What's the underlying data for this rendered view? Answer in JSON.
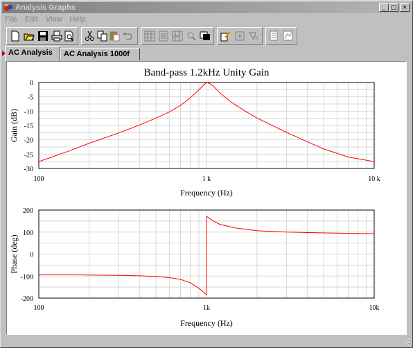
{
  "window": {
    "title": "Analysis Graphs",
    "controls": {
      "minimize": "_",
      "maximize": "□",
      "close": "×"
    }
  },
  "menu": [
    "File",
    "Edit",
    "View",
    "Help"
  ],
  "toolbar": {
    "buttons": [
      "new-icon",
      "open-icon",
      "save-icon",
      "print-icon",
      "print-preview-icon",
      "cut-icon",
      "copy-icon",
      "paste-icon",
      "undo-icon",
      "grid-icon",
      "legend-icon",
      "cursors-icon",
      "zoom-icon",
      "reverse-colors-icon",
      "properties-icon",
      "zoom-in-icon",
      "zoom-out-icon",
      "export-icon",
      "overlay-icon"
    ]
  },
  "tabs": [
    {
      "label": "AC Analysis",
      "active": true
    },
    {
      "label": "AC Analysis 1000f",
      "active": false
    }
  ],
  "colors": {
    "trace": "#ff0000",
    "grid": "#d8d8d8",
    "titlebar_inactive": "#808080"
  },
  "chart_data": [
    {
      "type": "line",
      "title": "Band-pass 1.2kHz Unity Gain",
      "xlabel": "Frequency (Hz)",
      "ylabel": "Gain (dB)",
      "xscale": "log",
      "xlim": [
        100,
        10000
      ],
      "ylim": [
        -30,
        0
      ],
      "xticks": [
        "100",
        "1 k",
        "10 k"
      ],
      "yticks": [
        "0",
        "-5",
        "-10",
        "-15",
        "-20",
        "-25",
        "-30"
      ],
      "grid": true,
      "series": [
        {
          "color": "#ff0000",
          "x": [
            100,
            150,
            200,
            300,
            400,
            500,
            600,
            700,
            800,
            900,
            950,
            1000,
            1050,
            1100,
            1200,
            1400,
            1700,
            2000,
            3000,
            4000,
            5000,
            7000,
            10000
          ],
          "y": [
            -27.6,
            -24.0,
            -21.2,
            -17.6,
            -14.8,
            -12.4,
            -10.3,
            -8.0,
            -5.4,
            -2.6,
            -1.2,
            0.0,
            -0.4,
            -1.3,
            -3.6,
            -6.8,
            -10.0,
            -12.4,
            -17.4,
            -20.7,
            -23.2,
            -26.0,
            -27.6
          ]
        }
      ]
    },
    {
      "type": "line",
      "title": "",
      "xlabel": "Frequency (Hz)",
      "ylabel": "Phase (deg)",
      "xscale": "log",
      "xlim": [
        100,
        10000
      ],
      "ylim": [
        -200,
        200
      ],
      "xticks": [
        "100",
        "1k",
        "10k"
      ],
      "yticks": [
        "200",
        "100",
        "0",
        "-100",
        "-200"
      ],
      "grid": true,
      "series": [
        {
          "color": "#ff0000",
          "x": [
            100,
            150,
            200,
            300,
            400,
            500,
            600,
            700,
            800,
            900,
            950,
            999,
            1001,
            1050,
            1100,
            1200,
            1500,
            2000,
            3000,
            5000,
            10000
          ],
          "y": [
            -93,
            -94,
            -95,
            -97,
            -99,
            -102,
            -107,
            -115,
            -130,
            -155,
            -170,
            -185,
            172,
            160,
            150,
            135,
            118,
            106,
            100,
            96,
            93
          ]
        }
      ]
    }
  ]
}
